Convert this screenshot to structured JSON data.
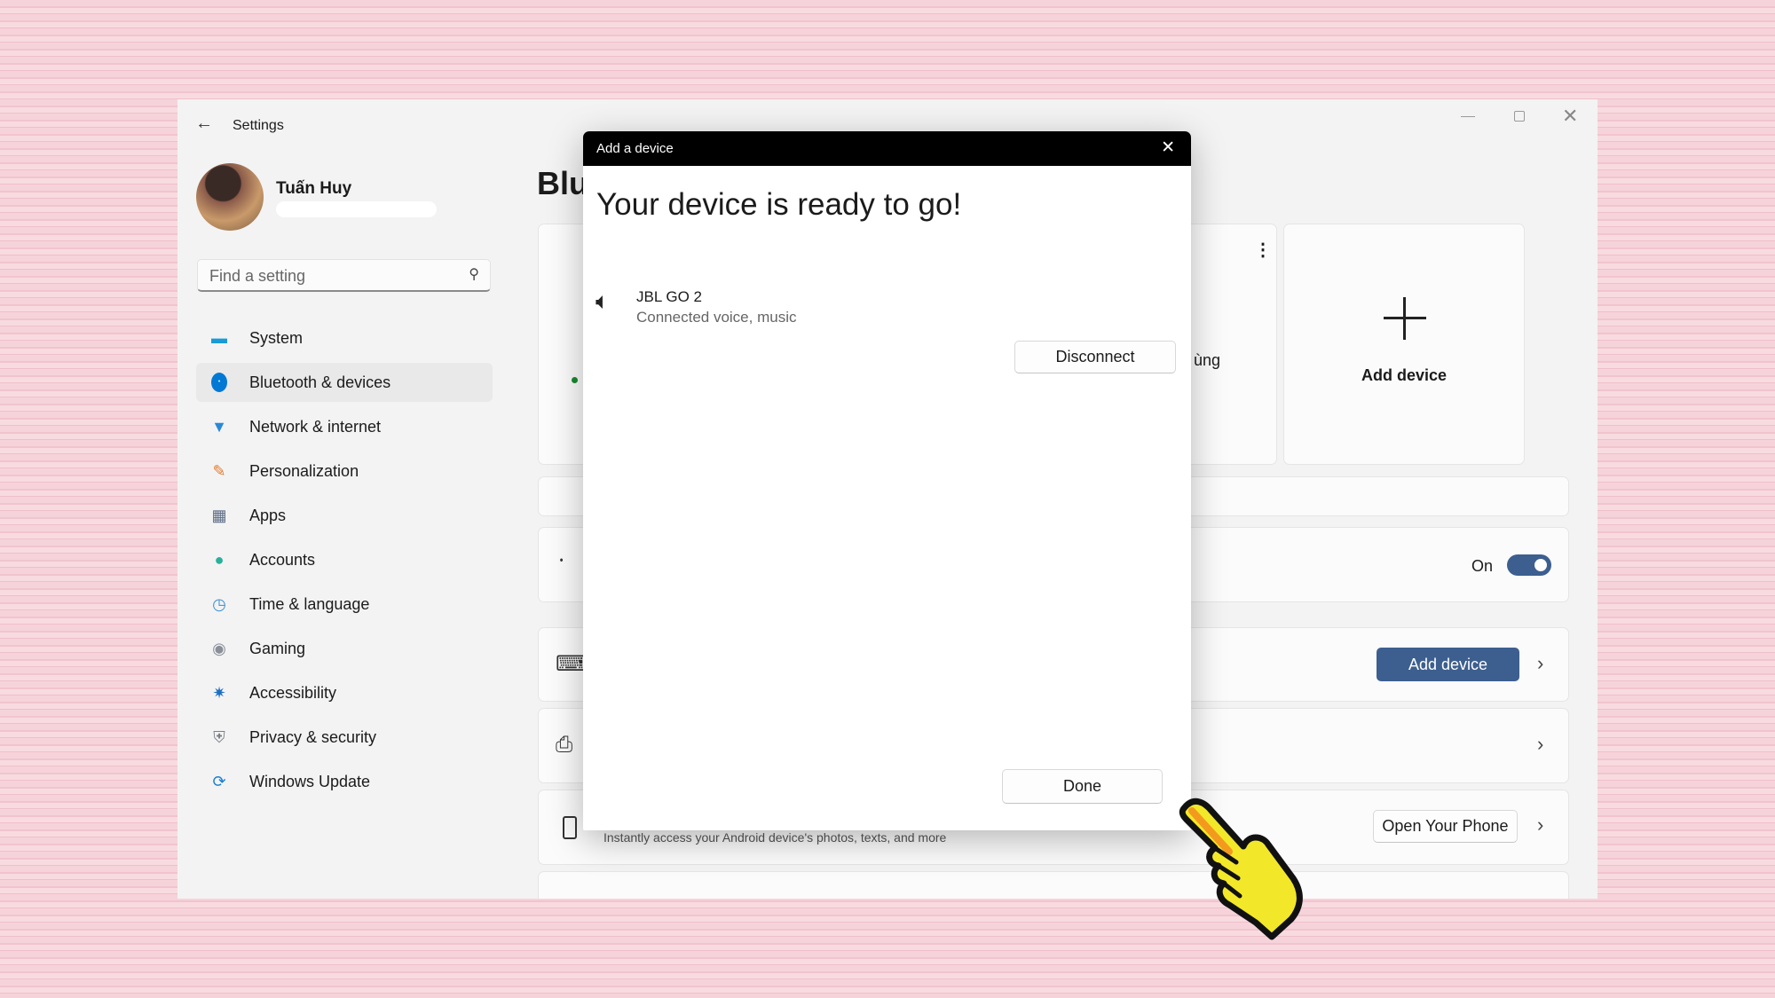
{
  "window": {
    "title": "Settings",
    "controls": [
      "minimize",
      "maximize",
      "close"
    ]
  },
  "user": {
    "name": "Tuấn Huy"
  },
  "search": {
    "placeholder": "Find a setting"
  },
  "sidebar": {
    "items": [
      {
        "label": "System",
        "icon": "monitor-icon",
        "color": "#1a9bd7"
      },
      {
        "label": "Bluetooth & devices",
        "icon": "bluetooth-icon",
        "color": "#0078d4",
        "active": true
      },
      {
        "label": "Network & internet",
        "icon": "wifi-icon",
        "color": "#2b88d8"
      },
      {
        "label": "Personalization",
        "icon": "brush-icon",
        "color": "#e07a30"
      },
      {
        "label": "Apps",
        "icon": "apps-icon",
        "color": "#5a6b85"
      },
      {
        "label": "Accounts",
        "icon": "person-icon",
        "color": "#2ab09a"
      },
      {
        "label": "Time & language",
        "icon": "globe-clock-icon",
        "color": "#3a8fd0"
      },
      {
        "label": "Gaming",
        "icon": "gamepad-icon",
        "color": "#8a8f99"
      },
      {
        "label": "Accessibility",
        "icon": "accessibility-icon",
        "color": "#1c6fc2"
      },
      {
        "label": "Privacy & security",
        "icon": "shield-icon",
        "color": "#7a7f88"
      },
      {
        "label": "Windows Update",
        "icon": "update-icon",
        "color": "#1a7fd0"
      }
    ]
  },
  "main": {
    "title_partial": "Blu",
    "device_card_text_partial": "ùng",
    "add_device_tile": "Add device",
    "bluetooth_state": "On",
    "bluetooth_on": true,
    "add_device_button": "Add device",
    "phone_desc": "Instantly access your Android device's photos, texts, and more",
    "open_phone_button": "Open Your Phone"
  },
  "dialog": {
    "title": "Add a device",
    "heading": "Your device is ready to go!",
    "device_name": "JBL GO 2",
    "device_status": "Connected voice, music",
    "disconnect": "Disconnect",
    "done": "Done"
  },
  "colors": {
    "accent": "#3d5f8f",
    "status_dot": "#1a8a2e"
  }
}
